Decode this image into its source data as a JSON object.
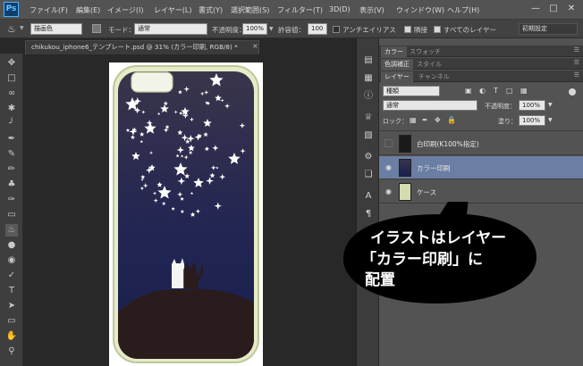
{
  "app": {
    "logo": "Ps"
  },
  "menu": [
    "ファイル(F)",
    "編集(E)",
    "イメージ(I)",
    "レイヤー(L)",
    "書式(Y)",
    "選択範囲(S)",
    "フィルター(T)",
    "3D(D)",
    "表示(V)",
    "ウィンドウ(W)",
    "ヘルプ(H)"
  ],
  "window": {
    "minimize": "—",
    "maximize": "□",
    "close": "✕"
  },
  "options": {
    "fill_source": "描画色",
    "mode_label": "モード：",
    "mode_value": "通常",
    "opacity_label": "不透明度：",
    "opacity_value": "100%",
    "tolerance_label": "許容値：",
    "tolerance_value": "100",
    "antialias_label": "アンチエイリアス",
    "antialias_checked": false,
    "contiguous_label": "隣接",
    "contiguous_checked": true,
    "all_layers_label": "すべてのレイヤー",
    "all_layers_checked": true,
    "preset": "初期設定"
  },
  "document": {
    "tab_title": "chikukou_iphone6_テンプレート.psd @ 31% (カラー印刷, RGB/8) *",
    "tab_close": "×"
  },
  "panels": {
    "tabs_row1": [
      "カラー",
      "スウォッチ"
    ],
    "tabs_row2": [
      "色調補正",
      "スタイル"
    ],
    "tabs_row3": [
      "レイヤー",
      "チャンネル"
    ],
    "filter_kind": "種類",
    "blend_mode": "通常",
    "opacity_label": "不透明度：",
    "opacity_value": "100%",
    "lock_label": "ロック：",
    "fill_label": "塗り：",
    "fill_value": "100%",
    "layers": [
      {
        "name": "白印刷(K100%指定)",
        "visible": false,
        "selected": false
      },
      {
        "name": "カラー印刷",
        "visible": true,
        "selected": true
      },
      {
        "name": "ケース",
        "visible": true,
        "selected": false
      }
    ]
  },
  "callout": {
    "line1": "イラストはレイヤー",
    "line2": "「カラー印刷」に",
    "line3": "配置"
  },
  "colors": {
    "sky_top": "#39354a",
    "sky_bottom": "#17204c",
    "case_frame": "#d4dcb0",
    "hill": "#2a1c1c",
    "layer_selected": "#6b7ea3"
  }
}
